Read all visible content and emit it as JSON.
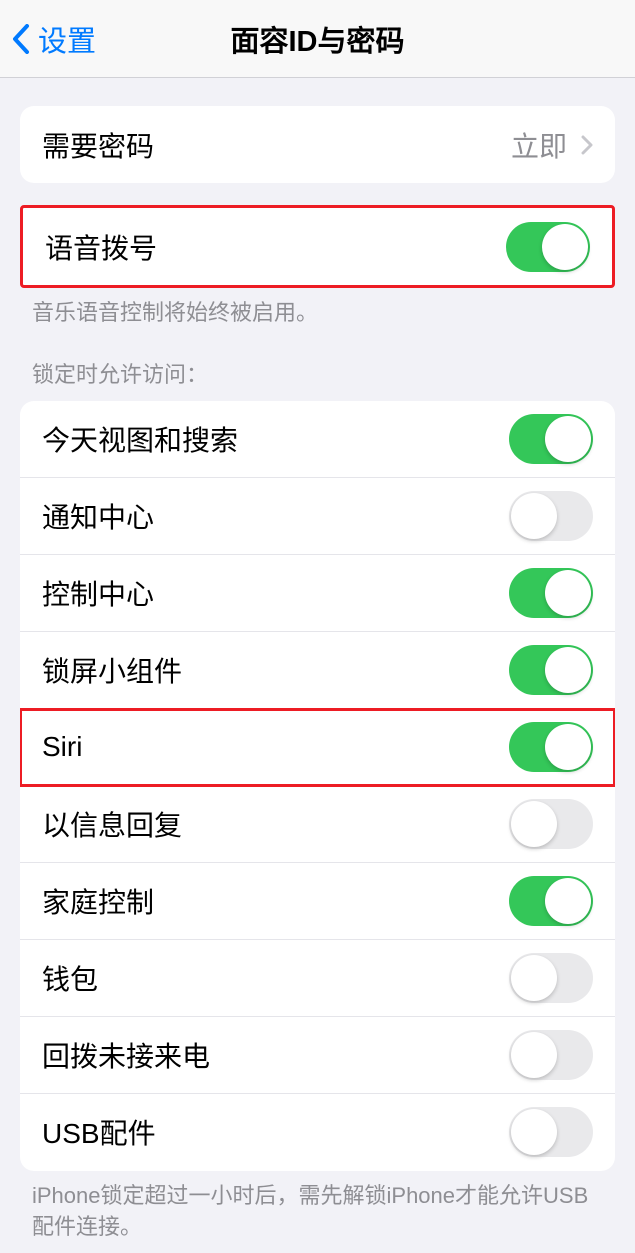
{
  "header": {
    "back_label": "设置",
    "title": "面容ID与密码"
  },
  "passcode_row": {
    "label": "需要密码",
    "value": "立即"
  },
  "voice_dial": {
    "label": "语音拨号",
    "on": true,
    "footer": "音乐语音控制将始终被启用。"
  },
  "lock_access": {
    "header": "锁定时允许访问：",
    "items": [
      {
        "label": "今天视图和搜索",
        "on": true
      },
      {
        "label": "通知中心",
        "on": false
      },
      {
        "label": "控制中心",
        "on": true
      },
      {
        "label": "锁屏小组件",
        "on": true
      },
      {
        "label": "Siri",
        "on": true
      },
      {
        "label": "以信息回复",
        "on": false
      },
      {
        "label": "家庭控制",
        "on": true
      },
      {
        "label": "钱包",
        "on": false
      },
      {
        "label": "回拨未接来电",
        "on": false
      },
      {
        "label": "USB配件",
        "on": false
      }
    ],
    "footer": "iPhone锁定超过一小时后，需先解锁iPhone才能允许USB配件连接。"
  }
}
